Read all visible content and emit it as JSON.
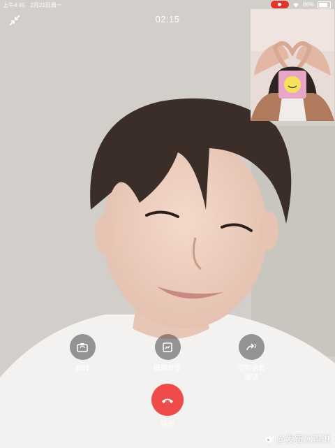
{
  "status_bar": {
    "time": "上午4:45",
    "date": "2月21日周一",
    "battery": "86%",
    "icons": [
      "recording-indicator",
      "wifi-icon",
      "battery-icon"
    ]
  },
  "call": {
    "timer": "02:15",
    "icons": [
      "minimize-icon",
      "self-camera-preview"
    ]
  },
  "controls": {
    "flip_label": "翻转",
    "blur_label": "模糊背景",
    "switch_audio_line1": "切到语音",
    "switch_audio_line2": "通话",
    "hangup_label": "挂断",
    "icons": [
      "flip-camera-icon",
      "blur-background-icon",
      "switch-audio-icon",
      "hangup-phone-icon"
    ]
  },
  "watermark": {
    "text": "@发霉冰淇淋",
    "icon": "weibo-logo"
  },
  "colors": {
    "hangup": "#ef4b4b",
    "recording": "#e0342c",
    "control_bg": "rgba(70,70,70,0.55)",
    "text": "#ffffff"
  }
}
